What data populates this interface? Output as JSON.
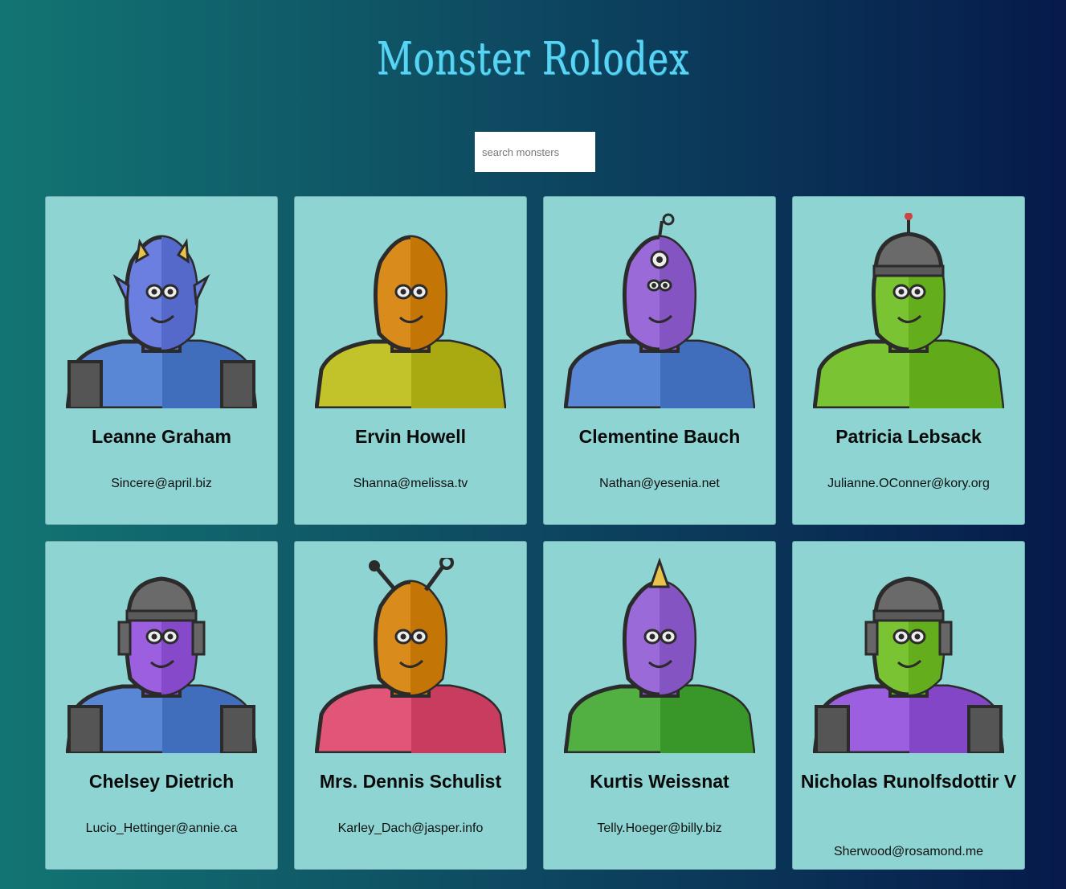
{
  "header": {
    "title": "Monster Rolodex"
  },
  "search": {
    "placeholder": "search monsters",
    "value": ""
  },
  "monsters": [
    {
      "name": "Leanne Graham",
      "email": "Sincere@april.biz",
      "skin": "#6b7fe0",
      "body": "#5a86d6",
      "features": "horns"
    },
    {
      "name": "Ervin Howell",
      "email": "Shanna@melissa.tv",
      "skin": "#d98b1c",
      "body": "#c2c22b",
      "features": "bald"
    },
    {
      "name": "Clementine Bauch",
      "email": "Nathan@yesenia.net",
      "skin": "#9b6ad9",
      "body": "#5a86d6",
      "features": "antenna"
    },
    {
      "name": "Patricia Lebsack",
      "email": "Julianne.OConner@kory.org",
      "skin": "#7ac433",
      "body": "#7ac433",
      "features": "helmet"
    },
    {
      "name": "Chelsey Dietrich",
      "email": "Lucio_Hettinger@annie.ca",
      "skin": "#9b5fe0",
      "body": "#5a86d6",
      "features": "robot"
    },
    {
      "name": "Mrs. Dennis Schulist",
      "email": "Karley_Dach@jasper.info",
      "skin": "#d98b1c",
      "body": "#e05578",
      "features": "antennae"
    },
    {
      "name": "Kurtis Weissnat",
      "email": "Telly.Hoeger@billy.biz",
      "skin": "#9b6ad9",
      "body": "#52b043",
      "features": "horn"
    },
    {
      "name": "Nicholas Runolfsdottir V",
      "email": "Sherwood@rosamond.me",
      "skin": "#7ac433",
      "body": "#9b5fe0",
      "features": "robot"
    }
  ]
}
